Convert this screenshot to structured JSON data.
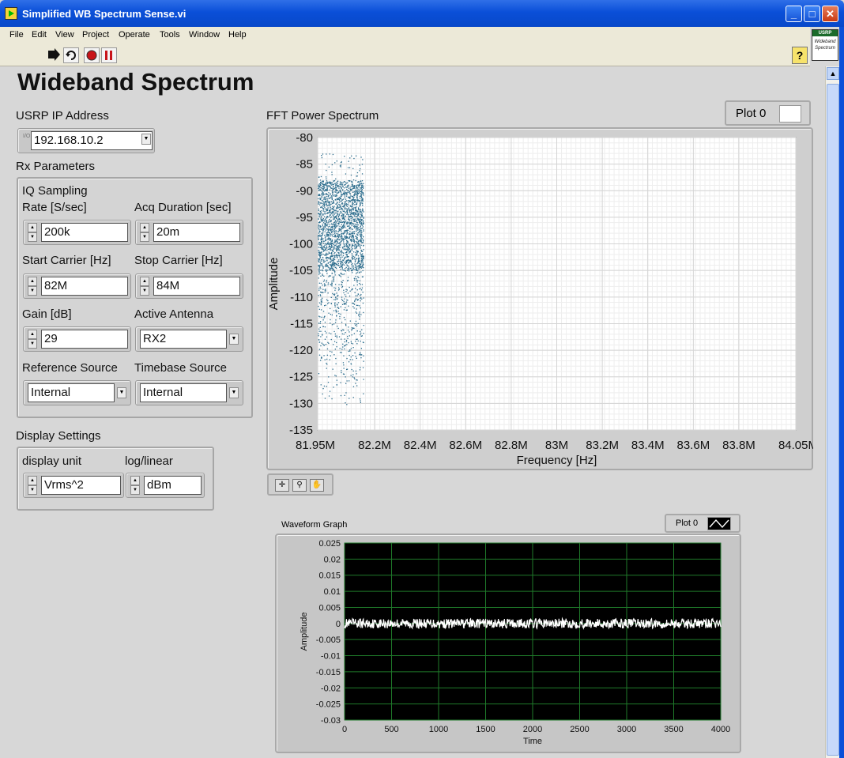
{
  "window": {
    "title": "Simplified WB Spectrum Sense.vi",
    "minimize": "_",
    "maximize": "□",
    "close": "✕"
  },
  "menu": [
    "File",
    "Edit",
    "View",
    "Project",
    "Operate",
    "Tools",
    "Window",
    "Help"
  ],
  "toolbar": {
    "run_icon": "run-arrow-icon",
    "run_continuous_icon": "run-continuously-icon",
    "abort_icon": "abort-icon",
    "pause_icon": "pause-icon",
    "help_label": "?"
  },
  "vi_icon": {
    "top": "USRP",
    "line1": "Wideband",
    "line2": "Spectrum"
  },
  "page_title": "Wideband Spectrum",
  "usrp_ip": {
    "label": "USRP IP Address",
    "value": "192.168.10.2",
    "prefix": "I/O"
  },
  "rx": {
    "label": "Rx Parameters",
    "iq_rate_label_1": "IQ Sampling",
    "iq_rate_label_2": "Rate [S/sec]",
    "iq_rate": "200k",
    "acq_label": "Acq Duration [sec]",
    "acq": "20m",
    "start_label": "Start Carrier [Hz]",
    "start": "82M",
    "stop_label": "Stop Carrier [Hz]",
    "stop": "84M",
    "gain_label": "Gain [dB]",
    "gain": "29",
    "antenna_label": "Active Antenna",
    "antenna": "RX2",
    "ref_label": "Reference Source",
    "ref": "Internal",
    "timebase_label": "Timebase Source",
    "timebase": "Internal"
  },
  "display": {
    "label": "Display Settings",
    "unit_label": "display unit",
    "unit": "Vrms^2",
    "loglin_label": "log/linear",
    "loglin": "dBm"
  },
  "fft_legend": "Plot 0",
  "waveform_legend": "Plot 0",
  "chart_data": [
    {
      "type": "scatter",
      "title": "FFT Power Spectrum",
      "xlabel": "Frequency [Hz]",
      "ylabel": "Amplitude",
      "xlim": [
        81950000,
        84050000
      ],
      "ylim": [
        -135,
        -80
      ],
      "x_ticks": [
        "81.95M",
        "82.2M",
        "82.4M",
        "82.6M",
        "82.8M",
        "83M",
        "83.2M",
        "83.4M",
        "83.6M",
        "83.8M",
        "84.05M"
      ],
      "y_ticks": [
        "-80",
        "-85",
        "-90",
        "-95",
        "-100",
        "-105",
        "-110",
        "-115",
        "-120",
        "-125",
        "-130",
        "-135"
      ],
      "grid": true,
      "legend": "top-right",
      "color": "#2e6e8e",
      "series": [
        {
          "name": "Plot 0",
          "x_range": [
            81950000,
            82150000
          ],
          "y_core": [
            -105,
            -88
          ],
          "y_extent": [
            -131,
            -83
          ]
        }
      ]
    },
    {
      "type": "line",
      "title": "Waveform Graph",
      "xlabel": "Time",
      "ylabel": "Amplitude",
      "xlim": [
        0,
        4000
      ],
      "ylim": [
        -0.03,
        0.025
      ],
      "x_ticks": [
        "0",
        "500",
        "1000",
        "1500",
        "2000",
        "2500",
        "3000",
        "3500",
        "4000"
      ],
      "y_ticks": [
        "0.025",
        "0.02",
        "0.015",
        "0.01",
        "0.005",
        "0",
        "-0.005",
        "-0.01",
        "-0.015",
        "-0.02",
        "-0.025",
        "-0.03"
      ],
      "grid": true,
      "legend": "top-right",
      "color": "#ffffff",
      "background": "#000000",
      "grid_color": "#1f7a2a",
      "series": [
        {
          "name": "Plot 0",
          "x_range": [
            0,
            4000
          ],
          "mean": 0,
          "noise_amplitude": 0.0015
        }
      ]
    }
  ]
}
